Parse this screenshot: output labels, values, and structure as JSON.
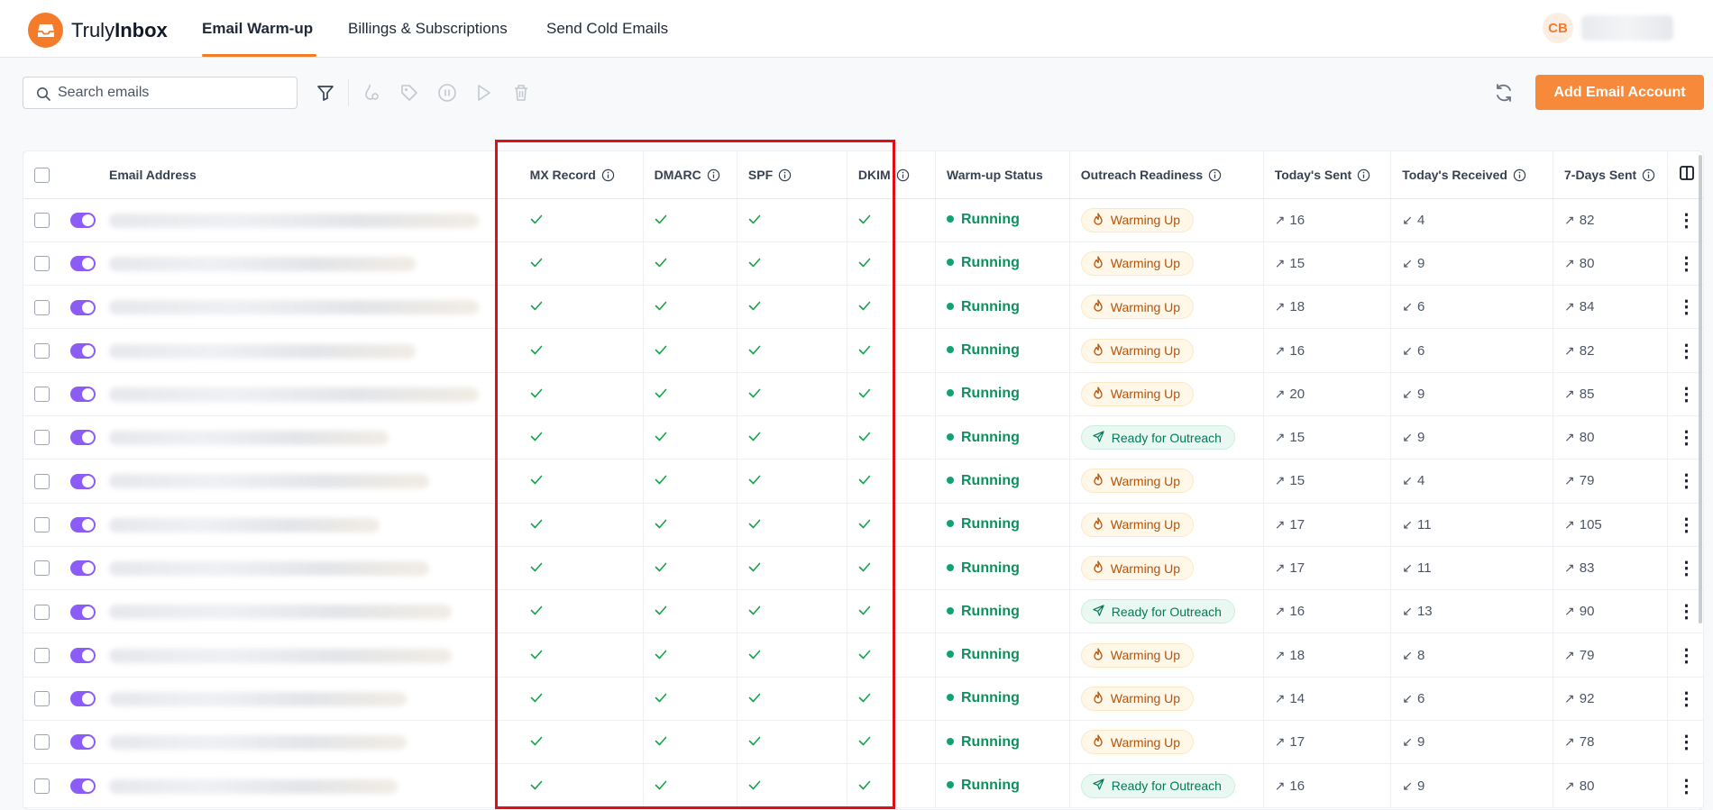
{
  "app": {
    "brand_light": "Truly",
    "brand_bold": "Inbox",
    "accent_color": "#f47b2a"
  },
  "nav": {
    "tabs": [
      {
        "label": "Email Warm-up",
        "active": true
      },
      {
        "label": "Billings & Subscriptions",
        "active": false
      },
      {
        "label": "Send Cold Emails",
        "active": false
      }
    ],
    "user_initials": "CB"
  },
  "toolbar": {
    "search_placeholder": "Search emails",
    "icons": [
      "filter-icon",
      "warmup-settings-icon",
      "tag-icon",
      "pause-icon",
      "play-icon",
      "trash-icon"
    ],
    "add_label": "Add Email Account"
  },
  "table": {
    "columns": {
      "email": "Email Address",
      "mx": "MX Record",
      "dmarc": "DMARC",
      "spf": "SPF",
      "dkim": "DKIM",
      "warmup_status": "Warm-up Status",
      "outreach": "Outreach Readiness",
      "today_sent": "Today's Sent",
      "today_received": "Today's Received",
      "seven_day_sent": "7-Days Sent"
    },
    "rows": [
      {
        "status": "Running",
        "readiness": "Warming Up",
        "ready": false,
        "sent": "16",
        "received": "4",
        "week": "82"
      },
      {
        "status": "Running",
        "readiness": "Warming Up",
        "ready": false,
        "sent": "15",
        "received": "9",
        "week": "80"
      },
      {
        "status": "Running",
        "readiness": "Warming Up",
        "ready": false,
        "sent": "18",
        "received": "6",
        "week": "84"
      },
      {
        "status": "Running",
        "readiness": "Warming Up",
        "ready": false,
        "sent": "16",
        "received": "6",
        "week": "82"
      },
      {
        "status": "Running",
        "readiness": "Warming Up",
        "ready": false,
        "sent": "20",
        "received": "9",
        "week": "85"
      },
      {
        "status": "Running",
        "readiness": "Ready for Outreach",
        "ready": true,
        "sent": "15",
        "received": "9",
        "week": "80"
      },
      {
        "status": "Running",
        "readiness": "Warming Up",
        "ready": false,
        "sent": "15",
        "received": "4",
        "week": "79"
      },
      {
        "status": "Running",
        "readiness": "Warming Up",
        "ready": false,
        "sent": "17",
        "received": "11",
        "week": "105"
      },
      {
        "status": "Running",
        "readiness": "Warming Up",
        "ready": false,
        "sent": "17",
        "received": "11",
        "week": "83"
      },
      {
        "status": "Running",
        "readiness": "Ready for Outreach",
        "ready": true,
        "sent": "16",
        "received": "13",
        "week": "90"
      },
      {
        "status": "Running",
        "readiness": "Warming Up",
        "ready": false,
        "sent": "18",
        "received": "8",
        "week": "79"
      },
      {
        "status": "Running",
        "readiness": "Warming Up",
        "ready": false,
        "sent": "14",
        "received": "6",
        "week": "92"
      },
      {
        "status": "Running",
        "readiness": "Warming Up",
        "ready": false,
        "sent": "17",
        "received": "9",
        "week": "78"
      },
      {
        "status": "Running",
        "readiness": "Ready for Outreach",
        "ready": true,
        "sent": "16",
        "received": "9",
        "week": "80"
      }
    ]
  }
}
